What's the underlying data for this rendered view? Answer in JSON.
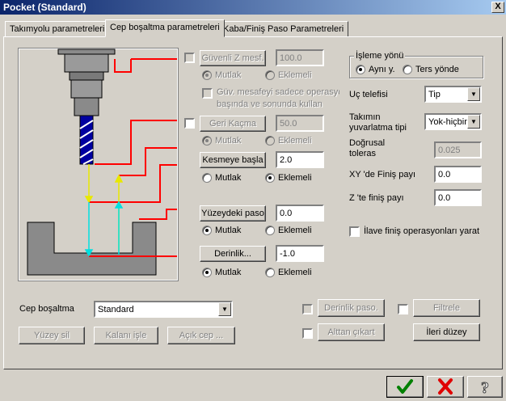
{
  "window": {
    "title": "Pocket (Standard)",
    "close_label": "X"
  },
  "tabs": [
    {
      "label": "Takımyolu parametreleri"
    },
    {
      "label": "Cep boşaltma parametreleri"
    },
    {
      "label": "Kaba/Finiş Paso Parametreleri"
    }
  ],
  "guvenli_z": {
    "label": "Güvenli Z mesf.",
    "value": "100.0",
    "mutlak": "Mutlak",
    "eklemeli": "Eklemeli",
    "note_line1": "Güv. mesafeyi sadece operasyc",
    "note_line2": "başında ve sonunda kullan"
  },
  "geri_kacma": {
    "label": "Geri Kaçma",
    "value": "50.0",
    "mutlak": "Mutlak",
    "eklemeli": "Eklemeli"
  },
  "kesmeye_basla": {
    "label": "Kesmeye başla",
    "value": "2.0",
    "mutlak": "Mutlak",
    "eklemeli": "Eklemeli"
  },
  "yuzeydeki_paso": {
    "label": "Yüzeydeki paso",
    "value": "0.0",
    "mutlak": "Mutlak",
    "eklemeli": "Eklemeli"
  },
  "derinlik": {
    "label": "Derinlik...",
    "value": "-1.0",
    "mutlak": "Mutlak",
    "eklemeli": "Eklemeli"
  },
  "isleme_yonu": {
    "title": "İşleme yönü",
    "option1": "Aynı y.",
    "option2": "Ters yönde"
  },
  "uc_telefisi": {
    "label": "Uç telefisi",
    "value": "Tip"
  },
  "takimin_yuvarlatma": {
    "label_line1": "Takımın",
    "label_line2": "yuvarlatma tipi",
    "value": "Yok-hiçbiri"
  },
  "dogrusal_toleras": {
    "label_line1": "Doğrusal",
    "label_line2": "toleras",
    "value": "0.025"
  },
  "xy_finis": {
    "label": "XY 'de Finiş payı",
    "value": "0.0"
  },
  "z_finis": {
    "label": "Z 'te finiş payı",
    "value": "0.0"
  },
  "ilave_finis": {
    "label": "İlave finiş operasyonları yarat"
  },
  "cep_bosaltma": {
    "label": "Cep boşaltma",
    "value": "Standard"
  },
  "bottom_buttons": {
    "yuzey_sil": "Yüzey sil",
    "kalani_isle": "Kalanı işle",
    "acik_cep": "Açık cep ...",
    "derinlik_paso": "Derinlik paso.",
    "filtrele": "Filtrele",
    "alttan_cikart": "Alttan çıkart",
    "ileri_duzey": "İleri düzey"
  },
  "dialog_buttons": {
    "ok_icon": "checkmark-icon",
    "cancel_icon": "red-x-icon",
    "help_icon": "question-mark-icon"
  },
  "colors": {
    "title_start": "#0a246a",
    "title_end": "#a6caf0",
    "diagram_red": "#ff0000",
    "diagram_yellow": "#e8e800",
    "diagram_cyan": "#00e0e0",
    "tool_blue": "#0000a0"
  }
}
